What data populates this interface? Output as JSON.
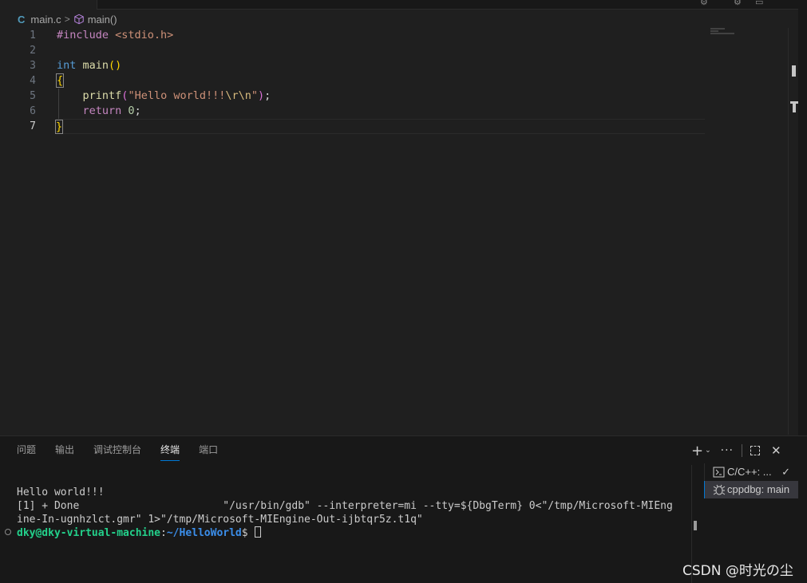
{
  "breadcrumb": {
    "file_icon": "C",
    "file": "main.c",
    "separator": ">",
    "symbol": "main()"
  },
  "editor": {
    "line_numbers": [
      "1",
      "2",
      "3",
      "4",
      "5",
      "6",
      "7"
    ],
    "active_line": 7
  },
  "code": {
    "l1_pp": "#include",
    "l1_header": " <stdio.h>",
    "l3_kw": "int",
    "l3_fn": " main",
    "l3_paren": "()",
    "l4_brace": "{",
    "l5_indent": "    ",
    "l5_fn": "printf",
    "l5_open": "(",
    "l5_str1": "\"Hello world!!!",
    "l5_esc": "\\r\\n",
    "l5_str2": "\"",
    "l5_close": ")",
    "l5_semi": ";",
    "l6_indent": "    ",
    "l6_kw": "return",
    "l6_num": " 0",
    "l6_semi": ";",
    "l7_brace": "}"
  },
  "panel": {
    "tabs": [
      "问题",
      "输出",
      "调试控制台",
      "终端",
      "端口"
    ],
    "active_tab": "终端",
    "actions": {
      "plus": "+",
      "chevron": "⌄",
      "more": "···",
      "close": "✕"
    }
  },
  "terminal": {
    "lines": [
      "Hello world!!!",
      "[1] + Done                       \"/usr/bin/gdb\" --interpreter=mi --tty=${DbgTerm} 0<\"/tmp/Microsoft-MIEng",
      "ine-In-ugnhzlct.gmr\" 1>\"/tmp/Microsoft-MIEngine-Out-ijbtqr5z.t1q\""
    ],
    "prompt_user": "dky@dky-virtual-machine",
    "prompt_sep": ":",
    "prompt_path": "~/HelloWorld",
    "prompt_symbol": "$"
  },
  "terminal_list": [
    {
      "icon": "terminal-icon",
      "label": "C/C++: ...",
      "check": "✓"
    },
    {
      "icon": "debug-icon",
      "label": "cppdbg: main"
    }
  ],
  "watermark": "CSDN @时光の尘",
  "colors": {
    "accent": "#0078d4",
    "prompt_green": "#23d18b",
    "prompt_blue": "#3b8eea"
  }
}
